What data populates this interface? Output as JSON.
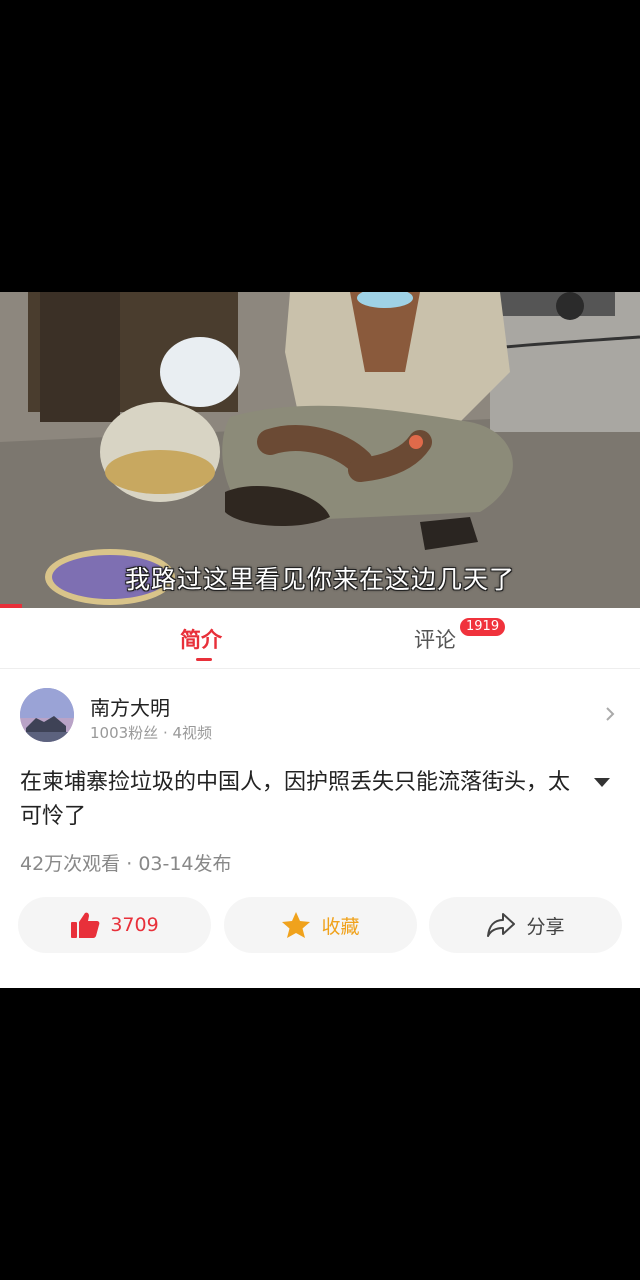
{
  "video": {
    "subtitle": "我路过这里看见你来在这边几天了",
    "progress": 0.035
  },
  "tabs": {
    "intro": "简介",
    "comments": "评论",
    "comments_badge": "1919"
  },
  "author": {
    "name": "南方大明",
    "followers": "1003粉丝",
    "videos": "4视频",
    "separator": " · "
  },
  "video_info": {
    "title": "在柬埔寨捡垃圾的中国人，因护照丢失只能流落街头，太可怜了",
    "views": "42万次观看",
    "date": "03-14发布",
    "separator": " · "
  },
  "actions": {
    "like_count": "3709",
    "favorite_label": "收藏",
    "share_label": "分享"
  },
  "colors": {
    "accent": "#e8303a",
    "favorite": "#f0a21c"
  }
}
